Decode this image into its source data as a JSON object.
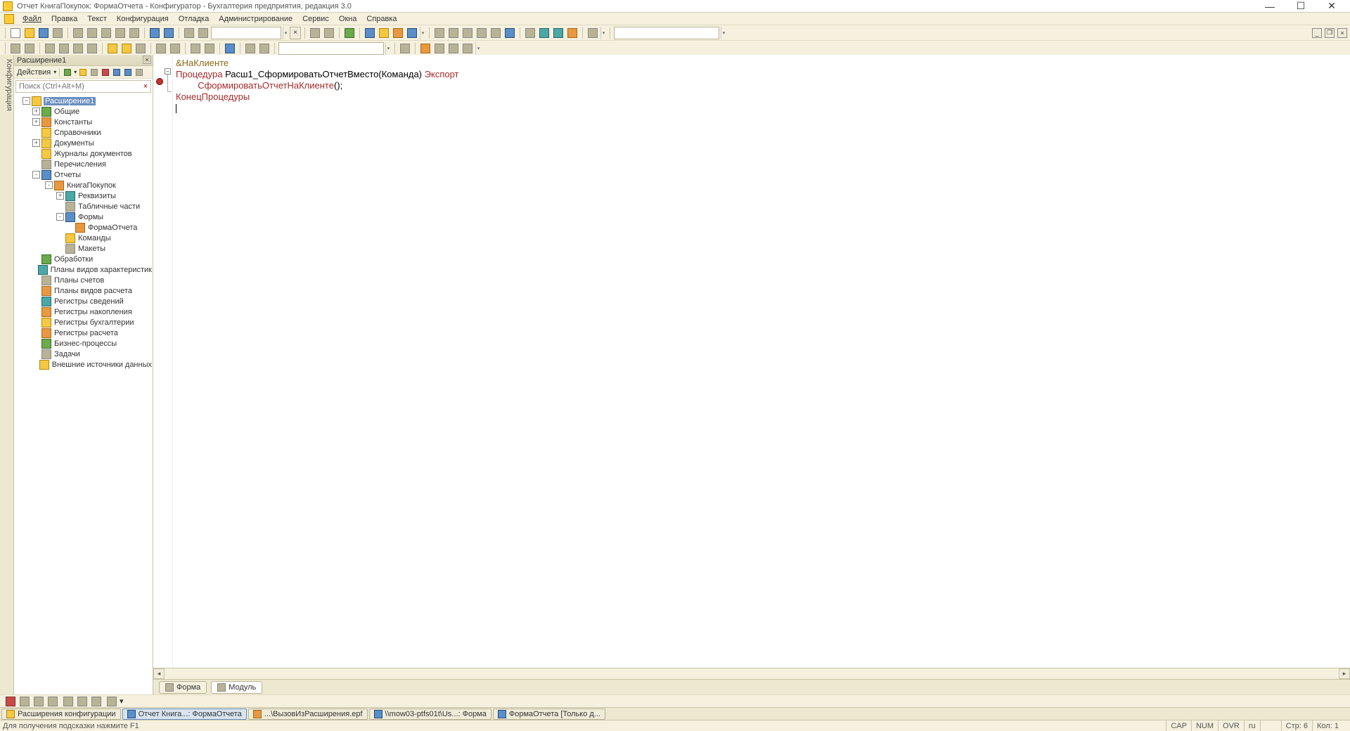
{
  "title": "Отчет КнигаПокупок: ФормаОтчета - Конфигуратор - Бухгалтерия предприятия, редакция 3.0",
  "menu": [
    "Файл",
    "Правка",
    "Текст",
    "Конфигурация",
    "Отладка",
    "Администрирование",
    "Сервис",
    "Окна",
    "Справка"
  ],
  "side_tab": "Конфигурация",
  "tree": {
    "title": "Расширение1",
    "actions_label": "Действия",
    "search_placeholder": "Поиск (Ctrl+Alt+M)",
    "root": "Расширение1",
    "nodes": [
      {
        "label": "Общие",
        "lvl": 2,
        "exp": "+",
        "ic": "ic-green"
      },
      {
        "label": "Константы",
        "lvl": 2,
        "exp": "+",
        "ic": "ic-orange"
      },
      {
        "label": "Справочники",
        "lvl": 2,
        "exp": "",
        "ic": "ic-yellow"
      },
      {
        "label": "Документы",
        "lvl": 2,
        "exp": "+",
        "ic": "ic-yellow"
      },
      {
        "label": "Журналы документов",
        "lvl": 2,
        "exp": "",
        "ic": "ic-yellow"
      },
      {
        "label": "Перечисления",
        "lvl": 2,
        "exp": "",
        "ic": "ic-gray"
      },
      {
        "label": "Отчеты",
        "lvl": 2,
        "exp": "-",
        "ic": "ic-blue"
      },
      {
        "label": "КнигаПокупок",
        "lvl": 3,
        "exp": "-",
        "ic": "ic-orange"
      },
      {
        "label": "Реквизиты",
        "lvl": 4,
        "exp": "+",
        "ic": "ic-teal"
      },
      {
        "label": "Табличные части",
        "lvl": 4,
        "exp": "",
        "ic": "ic-gray"
      },
      {
        "label": "Формы",
        "lvl": 4,
        "exp": "-",
        "ic": "ic-blue"
      },
      {
        "label": "ФормаОтчета",
        "lvl": 5,
        "exp": "",
        "ic": "ic-orange"
      },
      {
        "label": "Команды",
        "lvl": 4,
        "exp": "",
        "ic": "ic-yellow"
      },
      {
        "label": "Макеты",
        "lvl": 4,
        "exp": "",
        "ic": "ic-gray"
      },
      {
        "label": "Обработки",
        "lvl": 2,
        "exp": "",
        "ic": "ic-green"
      },
      {
        "label": "Планы видов характеристик",
        "lvl": 2,
        "exp": "",
        "ic": "ic-teal"
      },
      {
        "label": "Планы счетов",
        "lvl": 2,
        "exp": "",
        "ic": "ic-gray"
      },
      {
        "label": "Планы видов расчета",
        "lvl": 2,
        "exp": "",
        "ic": "ic-orange"
      },
      {
        "label": "Регистры сведений",
        "lvl": 2,
        "exp": "",
        "ic": "ic-teal"
      },
      {
        "label": "Регистры накопления",
        "lvl": 2,
        "exp": "",
        "ic": "ic-orange"
      },
      {
        "label": "Регистры бухгалтерии",
        "lvl": 2,
        "exp": "",
        "ic": "ic-yellow"
      },
      {
        "label": "Регистры расчета",
        "lvl": 2,
        "exp": "",
        "ic": "ic-orange"
      },
      {
        "label": "Бизнес-процессы",
        "lvl": 2,
        "exp": "",
        "ic": "ic-green"
      },
      {
        "label": "Задачи",
        "lvl": 2,
        "exp": "",
        "ic": "ic-gray"
      },
      {
        "label": "Внешние источники данных",
        "lvl": 2,
        "exp": "",
        "ic": "ic-yellow"
      }
    ]
  },
  "code": {
    "l1_dir": "&НаКлиенте",
    "l2_kw1": "Процедура ",
    "l2_name": "Расш1_СформироватьОтчетВместо",
    "l2_args": "(Команда) ",
    "l2_kw2": "Экспорт",
    "l3_call": "СформироватьОтчетНаКлиенте",
    "l3_rest": "();",
    "l4": "КонецПроцедуры"
  },
  "editor_tabs": [
    {
      "label": "Форма",
      "active": false
    },
    {
      "label": "Модуль",
      "active": true
    }
  ],
  "window_tabs": [
    {
      "label": "Расширения конфигурации",
      "ic": "ic-yellow"
    },
    {
      "label": "Отчет Книга...: ФормаОтчета",
      "ic": "ic-blue",
      "active": true
    },
    {
      "label": "...\\ВызовИзРасширения.epf",
      "ic": "ic-orange"
    },
    {
      "label": "\\\\mow03-ptfs01t\\Us...: Форма",
      "ic": "ic-blue"
    },
    {
      "label": "ФормаОтчета [Только д...",
      "ic": "ic-blue"
    }
  ],
  "status": {
    "hint": "Для получения подсказки нажмите F1",
    "cap": "CAP",
    "num": "NUM",
    "ovr": "OVR",
    "lang": "ru",
    "row": "Стр: 6",
    "col": "Кол: 1"
  }
}
